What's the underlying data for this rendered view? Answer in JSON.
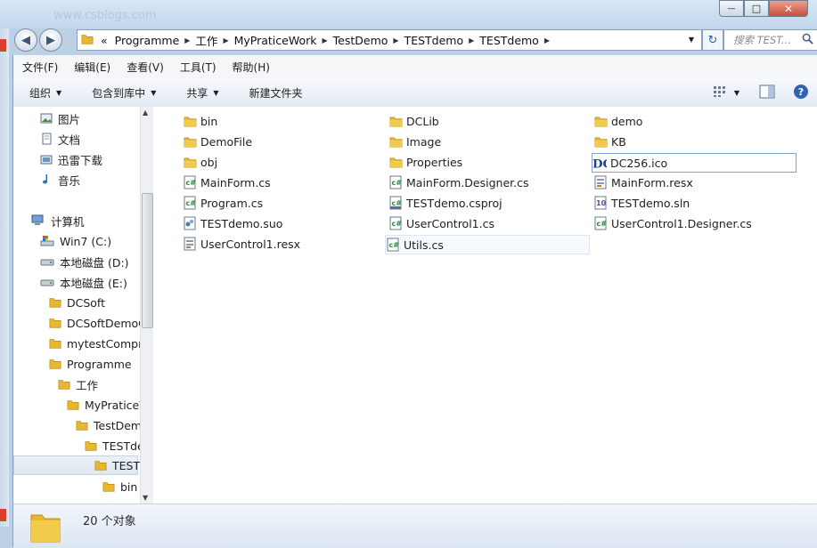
{
  "background": {
    "ghost_url": "www.csblogs.com"
  },
  "window": {
    "caption_min": "—",
    "caption_max": "□",
    "caption_close": "✕"
  },
  "nav": {
    "crumb_prefix": "«",
    "path": [
      "Programme",
      "工作",
      "MyPraticeWork",
      "TestDemo",
      "TESTdemo",
      "TESTdemo"
    ],
    "search_placeholder": "搜索 TEST..."
  },
  "menu": [
    "文件(F)",
    "编辑(E)",
    "查看(V)",
    "工具(T)",
    "帮助(H)"
  ],
  "toolbar": {
    "organize": "组织",
    "include": "包含到库中",
    "share": "共享",
    "new_folder": "新建文件夹"
  },
  "sidebar": [
    {
      "label": "图片",
      "icon": "pictures-icon"
    },
    {
      "label": "文档",
      "icon": "documents-icon"
    },
    {
      "label": "迅雷下载",
      "icon": "downloads-icon"
    },
    {
      "label": "音乐",
      "icon": "music-icon"
    },
    {
      "label": "计算机",
      "icon": "computer-icon"
    },
    {
      "label": "Win7 (C:)",
      "icon": "system-drive-icon"
    },
    {
      "label": "本地磁盘 (D:)",
      "icon": "drive-icon"
    },
    {
      "label": "本地磁盘 (E:)",
      "icon": "drive-icon"
    },
    {
      "label": "DCSoft",
      "icon": "folder-icon"
    },
    {
      "label": "DCSoftDemoC",
      "icon": "folder-icon"
    },
    {
      "label": "mytestCompr",
      "icon": "folder-icon"
    },
    {
      "label": "Programme",
      "icon": "folder-icon"
    },
    {
      "label": "工作",
      "icon": "folder-icon"
    },
    {
      "label": "MyPraticeV",
      "icon": "folder-icon"
    },
    {
      "label": "TestDem",
      "icon": "folder-icon"
    },
    {
      "label": "TESTde",
      "icon": "folder-icon"
    },
    {
      "label": "TEST",
      "icon": "folder-icon"
    },
    {
      "label": "bin",
      "icon": "folder-icon"
    }
  ],
  "files": [
    {
      "name": "bin",
      "icon": "folder-icon"
    },
    {
      "name": "DCLib",
      "icon": "folder-icon"
    },
    {
      "name": "demo",
      "icon": "folder-icon"
    },
    {
      "name": "DemoFile",
      "icon": "folder-icon"
    },
    {
      "name": "Image",
      "icon": "folder-icon"
    },
    {
      "name": "KB",
      "icon": "folder-icon"
    },
    {
      "name": "obj",
      "icon": "folder-icon"
    },
    {
      "name": "Properties",
      "icon": "folder-icon"
    },
    {
      "name": "DC256.ico",
      "icon": "dc-ico-icon"
    },
    {
      "name": "MainForm.cs",
      "icon": "csharp-file-icon"
    },
    {
      "name": "MainForm.Designer.cs",
      "icon": "csharp-file-icon"
    },
    {
      "name": "MainForm.resx",
      "icon": "resx-file-icon"
    },
    {
      "name": "Program.cs",
      "icon": "csharp-file-icon"
    },
    {
      "name": "TESTdemo.csproj",
      "icon": "csproj-file-icon"
    },
    {
      "name": "TESTdemo.sln",
      "icon": "sln-file-icon"
    },
    {
      "name": "TESTdemo.suo",
      "icon": "suo-file-icon"
    },
    {
      "name": "UserControl1.cs",
      "icon": "csharp-file-icon"
    },
    {
      "name": "UserControl1.Designer.cs",
      "icon": "csharp-file-icon"
    },
    {
      "name": "UserControl1.resx",
      "icon": "resx-file-icon"
    },
    {
      "name": "Utils.cs",
      "icon": "csharp-file-icon"
    }
  ],
  "status": {
    "count": "20 个对象"
  },
  "colors": {
    "folder": "#e8b730",
    "selection_border": "#7da2ce",
    "accent": "#2f5f9f"
  }
}
